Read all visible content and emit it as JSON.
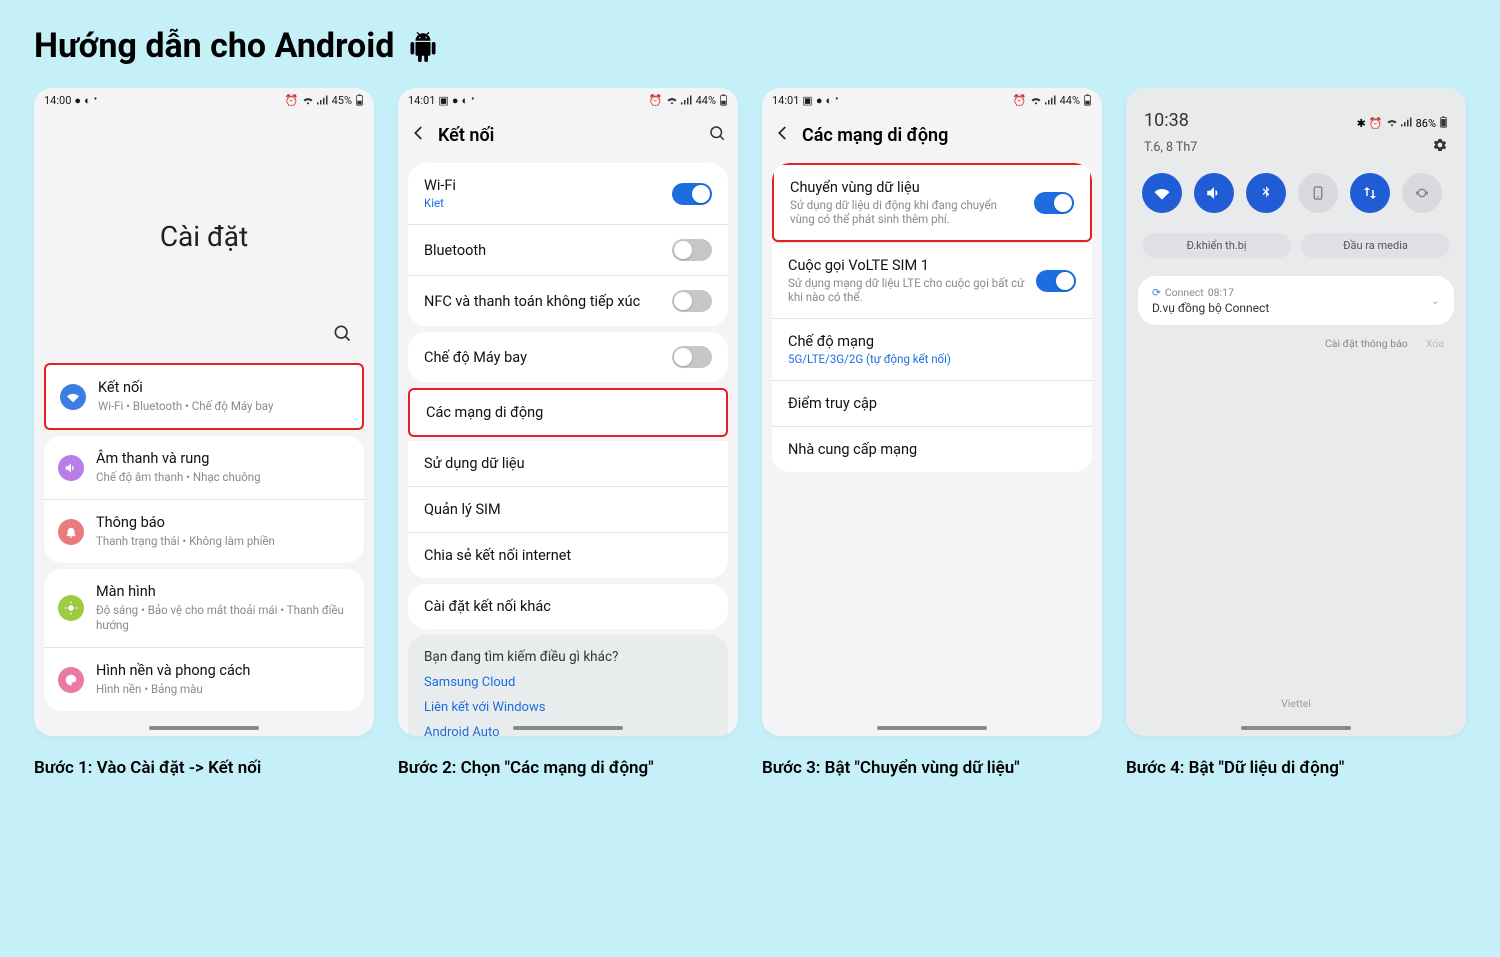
{
  "page": {
    "title": "Hướng dẫn cho Android"
  },
  "captions": {
    "step1": "Bước 1: Vào Cài đặt -> Kết nối",
    "step2": "Bước 2: Chọn \"Các mạng di động\"",
    "step3": "Bước 3: Bật \"Chuyển vùng dữ liệu\"",
    "step4": "Bước 4: Bật \"Dữ liệu di động\""
  },
  "phone1": {
    "status": {
      "time": "14:00",
      "battery": "45%"
    },
    "big_title": "Cài đặt",
    "rows": {
      "connections": {
        "label": "Kết nối",
        "sub": "Wi-Fi  •  Bluetooth  •  Chế độ Máy bay"
      },
      "sound": {
        "label": "Âm thanh và rung",
        "sub": "Chế độ âm thanh  •  Nhạc chuông"
      },
      "notif": {
        "label": "Thông báo",
        "sub": "Thanh trạng thái  •  Không làm phiền"
      },
      "display": {
        "label": "Màn hình",
        "sub": "Độ sáng  •  Bảo vệ cho mắt thoải mái  •  Thanh điều hướng"
      },
      "wallpaper": {
        "label": "Hình nền và phong cách",
        "sub": "Hình nền  •  Bảng màu"
      }
    }
  },
  "phone2": {
    "status": {
      "time": "14:01",
      "battery": "44%"
    },
    "header": "Kết nối",
    "wifi": {
      "label": "Wi-Fi",
      "sub": "Kiet"
    },
    "bt": {
      "label": "Bluetooth"
    },
    "nfc": {
      "label": "NFC và thanh toán không tiếp xúc"
    },
    "airplane": {
      "label": "Chế độ Máy bay"
    },
    "mobile": {
      "label": "Các mạng di động"
    },
    "data_use": {
      "label": "Sử dụng dữ liệu"
    },
    "sim_mgr": {
      "label": "Quản lý SIM"
    },
    "tether": {
      "label": "Chia sẻ kết nối internet"
    },
    "more": {
      "label": "Cài đặt kết nối khác"
    },
    "suggest": {
      "question": "Bạn đang tìm kiếm điều gì khác?",
      "links": [
        "Samsung Cloud",
        "Liên kết với Windows",
        "Android Auto"
      ]
    }
  },
  "phone3": {
    "status": {
      "time": "14:01",
      "battery": "44%"
    },
    "header": "Các mạng di động",
    "roaming": {
      "label": "Chuyển vùng dữ liệu",
      "sub": "Sử dụng dữ liệu di động khi đang chuyển vùng có thể phát sinh thêm phí."
    },
    "volte": {
      "label": "Cuộc gọi VoLTE SIM 1",
      "sub": "Sử dụng mạng dữ liệu LTE cho cuộc gọi bất cứ khi nào có thể."
    },
    "netmode": {
      "label": "Chế độ mạng",
      "sub": "5G/LTE/3G/2G (tự động kết nối)"
    },
    "apn": {
      "label": "Điểm truy cập"
    },
    "oper": {
      "label": "Nhà cung cấp mạng"
    }
  },
  "phone4": {
    "status": {
      "time": "10:38",
      "battery": "86%"
    },
    "date": "T.6, 8 Th7",
    "buttons": {
      "device_ctrl": "Đ.khiển th.bị",
      "media_out": "Đầu ra media"
    },
    "notif": {
      "app": "Connect",
      "app_time": "08:17",
      "title": "D.vụ đồng bộ Connect"
    },
    "footer": {
      "settings": "Cài đặt thông báo",
      "clear": "Xóa"
    },
    "carrier": "Viettel"
  }
}
